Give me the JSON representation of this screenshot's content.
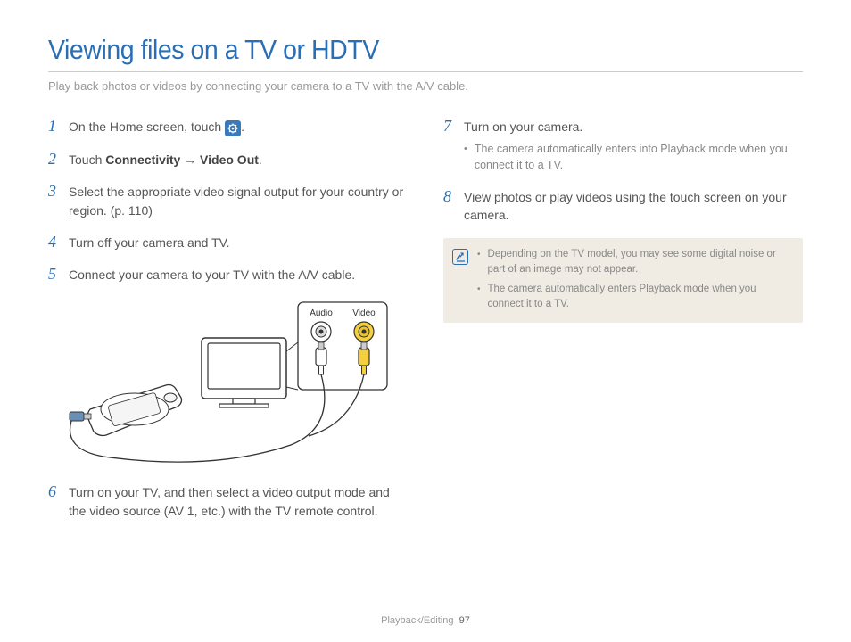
{
  "title": "Viewing files on a TV or HDTV",
  "subtitle": "Play back photos or videos by connecting your camera to a TV with the A/V cable.",
  "steps_left": [
    {
      "num": "1",
      "pre": "On the Home screen, touch ",
      "post": "."
    },
    {
      "num": "2",
      "pre": "Touch ",
      "b1": "Connectivity",
      "arrow": " → ",
      "b2": "Video Out",
      "post": "."
    },
    {
      "num": "3",
      "text": "Select the appropriate video signal output for your country or region. (p. 110)"
    },
    {
      "num": "4",
      "text": "Turn off your camera and TV."
    },
    {
      "num": "5",
      "text": "Connect your camera to your TV with the A/V cable."
    },
    {
      "num": "6",
      "text": "Turn on your TV, and then select a video output mode and the video source (AV 1, etc.) with the TV remote control."
    }
  ],
  "steps_right": [
    {
      "num": "7",
      "text": "Turn on your camera.",
      "bullet": "The camera automatically enters into Playback mode when you connect it to a TV."
    },
    {
      "num": "8",
      "text": "View photos or play videos using the touch screen on your camera."
    }
  ],
  "diagram": {
    "audio_label": "Audio",
    "video_label": "Video"
  },
  "notes": [
    "Depending on the TV model, you may see some digital noise or part of an image may not appear.",
    "The camera automatically enters Playback mode when you connect it to a TV."
  ],
  "footer": {
    "section": "Playback/Editing",
    "page": "97"
  }
}
